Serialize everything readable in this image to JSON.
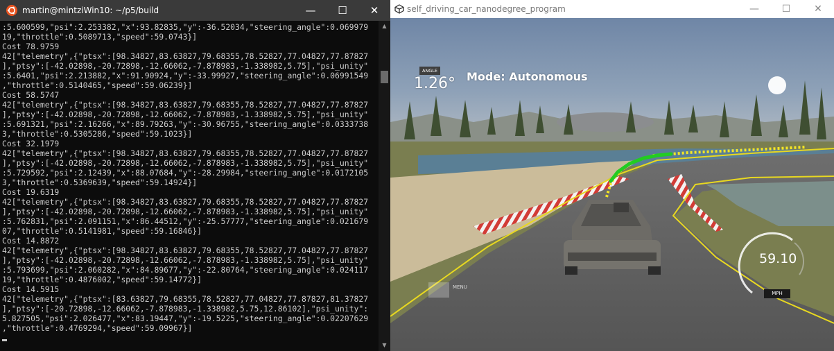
{
  "terminal": {
    "title": "martin@mintziWin10: ~/p5/build",
    "controls": {
      "minimize": "—",
      "maximize": "☐",
      "close": "✕"
    },
    "lines": [
      ":5.600599,\"psi\":2.253382,\"x\":93.82835,\"y\":-36.52034,\"steering_angle\":0.069979",
      "19,\"throttle\":0.5089713,\"speed\":59.0743}]",
      "Cost 78.9759",
      "42[\"telemetry\",{\"ptsx\":[98.34827,83.63827,79.68355,78.52827,77.04827,77.87827",
      "],\"ptsy\":[-42.02898,-20.72898,-12.66062,-7.878983,-1.338982,5.75],\"psi_unity\"",
      ":5.6401,\"psi\":2.213882,\"x\":91.90924,\"y\":-33.99927,\"steering_angle\":0.06991549",
      ",\"throttle\":0.5140465,\"speed\":59.06239}]",
      "Cost 58.5747",
      "42[\"telemetry\",{\"ptsx\":[98.34827,83.63827,79.68355,78.52827,77.04827,77.87827",
      "],\"ptsy\":[-42.02898,-20.72898,-12.66062,-7.878983,-1.338982,5.75],\"psi_unity\"",
      ":5.691321,\"psi\":2.16266,\"x\":89.79263,\"y\":-30.96755,\"steering_angle\":0.0333738",
      "3,\"throttle\":0.5305286,\"speed\":59.1023}]",
      "Cost 32.1979",
      "42[\"telemetry\",{\"ptsx\":[98.34827,83.63827,79.68355,78.52827,77.04827,77.87827",
      "],\"ptsy\":[-42.02898,-20.72898,-12.66062,-7.878983,-1.338982,5.75],\"psi_unity\"",
      ":5.729592,\"psi\":2.12439,\"x\":88.07684,\"y\":-28.29984,\"steering_angle\":0.0172105",
      "3,\"throttle\":0.5369639,\"speed\":59.14924}]",
      "Cost 19.6319",
      "42[\"telemetry\",{\"ptsx\":[98.34827,83.63827,79.68355,78.52827,77.04827,77.87827",
      "],\"ptsy\":[-42.02898,-20.72898,-12.66062,-7.878983,-1.338982,5.75],\"psi_unity\"",
      ":5.762831,\"psi\":2.091151,\"x\":86.44512,\"y\":-25.57777,\"steering_angle\":0.021679",
      "07,\"throttle\":0.5141981,\"speed\":59.16846}]",
      "Cost 14.8872",
      "42[\"telemetry\",{\"ptsx\":[98.34827,83.63827,79.68355,78.52827,77.04827,77.87827",
      "],\"ptsy\":[-42.02898,-20.72898,-12.66062,-7.878983,-1.338982,5.75],\"psi_unity\"",
      ":5.793699,\"psi\":2.060282,\"x\":84.89677,\"y\":-22.80764,\"steering_angle\":0.024117",
      "19,\"throttle\":0.4876002,\"speed\":59.14772}]",
      "Cost 14.5915",
      "42[\"telemetry\",{\"ptsx\":[83.63827,79.68355,78.52827,77.04827,77.87827,81.37827",
      "],\"ptsy\":[-20.72898,-12.66062,-7.878983,-1.338982,5.75,12.86102],\"psi_unity\":",
      "5.827505,\"psi\":2.026477,\"x\":83.19447,\"y\":-19.5225,\"steering_angle\":0.02207629",
      ",\"throttle\":0.4769294,\"speed\":59.09967}]"
    ],
    "scroll_up": "▲",
    "scroll_down": "▼"
  },
  "simulator": {
    "title": "self_driving_car_nanodegree_program",
    "controls": {
      "minimize": "—",
      "maximize": "☐",
      "close": "✕"
    },
    "hud": {
      "angle_label": "ANGLE",
      "angle_value": "1.26°",
      "mode": "Mode: Autonomous",
      "speed": "59.10",
      "speed_unit": "MPH",
      "speed_fraction": 0.55,
      "menu_label": "MENU"
    },
    "colors": {
      "sky": "#7b90ad",
      "road": "#5e5e5e",
      "waypoints_reference": "#f5e625",
      "waypoints_predicted": "#22cc22",
      "lane_line": "#e8d820"
    }
  }
}
